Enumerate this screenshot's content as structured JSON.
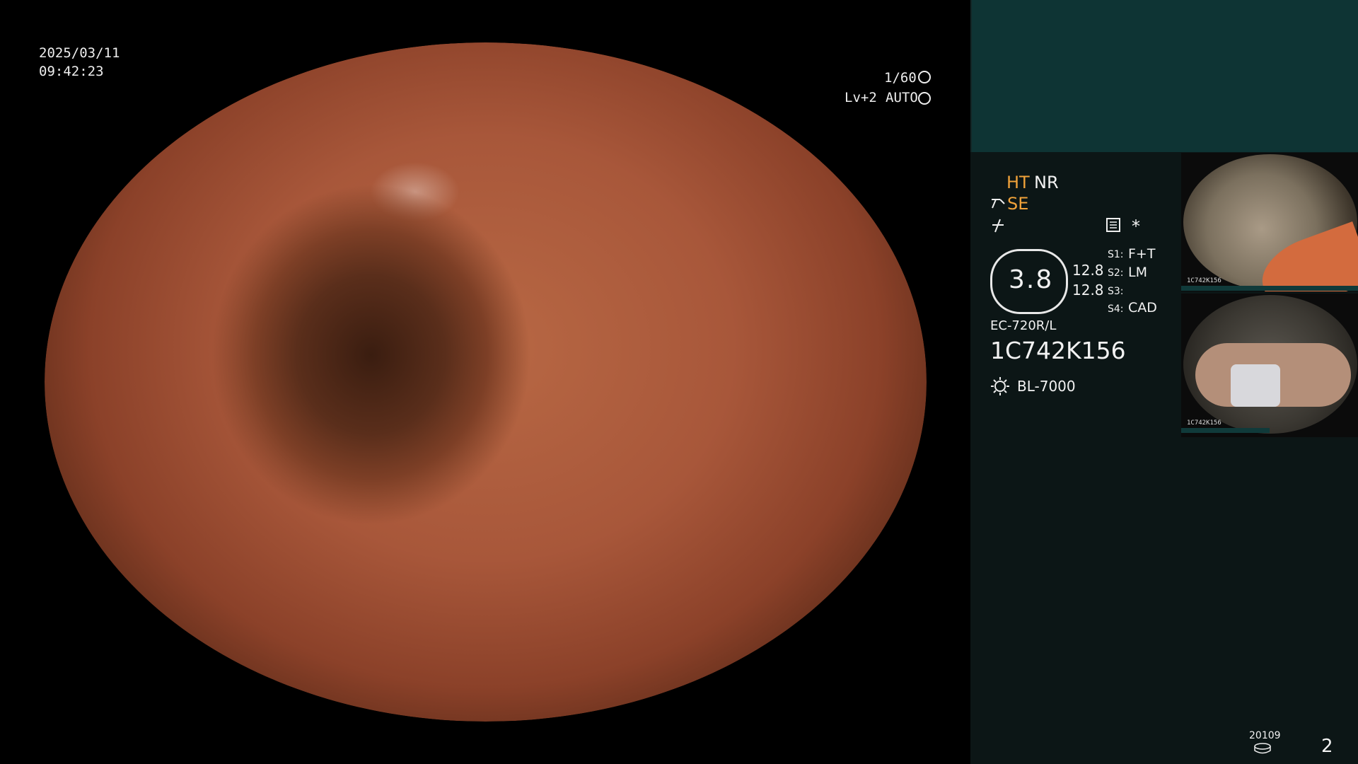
{
  "osd": {
    "date": "2025/03/11",
    "time": "09:42:23",
    "shutter": "1/60",
    "shutter_icon": "aperture-icon",
    "level": "Lv+2",
    "auto": "AUTO",
    "auto_icon": "iris-icon"
  },
  "panel": {
    "ht": "HT",
    "nr": "NR",
    "se": "SE",
    "enhance_icon": "enhance-icon",
    "freeze_icon": "freeze-icon",
    "record_icon": "record-icon",
    "asterisk": "*",
    "zoom_value": "3.8",
    "values": [
      "12.8",
      "12.8"
    ],
    "switches": [
      {
        "key": "S1:",
        "value": "F+T"
      },
      {
        "key": "S2:",
        "value": "LM"
      },
      {
        "key": "S3:",
        "value": ""
      },
      {
        "key": "S4:",
        "value": "CAD"
      }
    ],
    "scope_model": "EC-720R/L",
    "scope_serial": "1C742K156",
    "light_icon": "light-source-icon",
    "light_source": "BL-7000",
    "footer_code": "20109",
    "footer_icon": "disk-icon",
    "page_number": "2"
  },
  "thumbnails": [
    {
      "label": "1C742K156",
      "icon": "room-camera-icon"
    },
    {
      "label": "1C742K156",
      "icon": "hand-camera-icon"
    }
  ]
}
